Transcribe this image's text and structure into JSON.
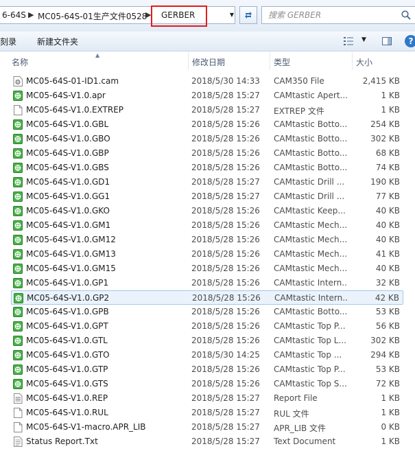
{
  "address": {
    "crumbs": [
      "6-64S",
      "MC05-64S-01生产文件0528",
      "GERBER"
    ],
    "separator": "▶"
  },
  "search": {
    "placeholder": "搜索 GERBER"
  },
  "toolbar": {
    "burn_label": "刻录",
    "new_folder_label": "新建文件夹"
  },
  "columns": {
    "name": "名称",
    "date": "修改日期",
    "type": "类型",
    "size": "大小"
  },
  "files": [
    {
      "name": "MC05-64S-01-ID1.cam",
      "date": "2018/5/30 14:33",
      "type": "CAM350 File",
      "size": "2,415 KB",
      "icon": "cam-icon"
    },
    {
      "name": "MC05-64S-V1.0.apr",
      "date": "2018/5/28 15:27",
      "type": "CAMtastic Apert...",
      "size": "1 KB",
      "icon": "camtastic-icon"
    },
    {
      "name": "MC05-64S-V1.0.EXTREP",
      "date": "2018/5/28 15:27",
      "type": "EXTREP 文件",
      "size": "1 KB",
      "icon": "blank-file-icon"
    },
    {
      "name": "MC05-64S-V1.0.GBL",
      "date": "2018/5/28 15:26",
      "type": "CAMtastic Botto...",
      "size": "254 KB",
      "icon": "camtastic-icon"
    },
    {
      "name": "MC05-64S-V1.0.GBO",
      "date": "2018/5/28 15:26",
      "type": "CAMtastic Botto...",
      "size": "302 KB",
      "icon": "camtastic-icon"
    },
    {
      "name": "MC05-64S-V1.0.GBP",
      "date": "2018/5/28 15:26",
      "type": "CAMtastic Botto...",
      "size": "68 KB",
      "icon": "camtastic-icon"
    },
    {
      "name": "MC05-64S-V1.0.GBS",
      "date": "2018/5/28 15:26",
      "type": "CAMtastic Botto...",
      "size": "74 KB",
      "icon": "camtastic-icon"
    },
    {
      "name": "MC05-64S-V1.0.GD1",
      "date": "2018/5/28 15:27",
      "type": "CAMtastic Drill ...",
      "size": "190 KB",
      "icon": "camtastic-icon"
    },
    {
      "name": "MC05-64S-V1.0.GG1",
      "date": "2018/5/28 15:27",
      "type": "CAMtastic Drill ...",
      "size": "77 KB",
      "icon": "camtastic-icon"
    },
    {
      "name": "MC05-64S-V1.0.GKO",
      "date": "2018/5/28 15:26",
      "type": "CAMtastic Keep...",
      "size": "40 KB",
      "icon": "camtastic-icon"
    },
    {
      "name": "MC05-64S-V1.0.GM1",
      "date": "2018/5/28 15:26",
      "type": "CAMtastic Mech...",
      "size": "40 KB",
      "icon": "camtastic-icon"
    },
    {
      "name": "MC05-64S-V1.0.GM12",
      "date": "2018/5/28 15:26",
      "type": "CAMtastic Mech...",
      "size": "40 KB",
      "icon": "camtastic-icon"
    },
    {
      "name": "MC05-64S-V1.0.GM13",
      "date": "2018/5/28 15:26",
      "type": "CAMtastic Mech...",
      "size": "41 KB",
      "icon": "camtastic-icon"
    },
    {
      "name": "MC05-64S-V1.0.GM15",
      "date": "2018/5/28 15:26",
      "type": "CAMtastic Mech...",
      "size": "40 KB",
      "icon": "camtastic-icon"
    },
    {
      "name": "MC05-64S-V1.0.GP1",
      "date": "2018/5/28 15:26",
      "type": "CAMtastic Intern...",
      "size": "32 KB",
      "icon": "camtastic-icon"
    },
    {
      "name": "MC05-64S-V1.0.GP2",
      "date": "2018/5/28 15:26",
      "type": "CAMtastic Intern...",
      "size": "42 KB",
      "icon": "camtastic-icon",
      "selected": true
    },
    {
      "name": "MC05-64S-V1.0.GPB",
      "date": "2018/5/28 15:26",
      "type": "CAMtastic Botto...",
      "size": "53 KB",
      "icon": "camtastic-icon"
    },
    {
      "name": "MC05-64S-V1.0.GPT",
      "date": "2018/5/28 15:26",
      "type": "CAMtastic Top P...",
      "size": "56 KB",
      "icon": "camtastic-icon"
    },
    {
      "name": "MC05-64S-V1.0.GTL",
      "date": "2018/5/28 15:26",
      "type": "CAMtastic Top L...",
      "size": "302 KB",
      "icon": "camtastic-icon"
    },
    {
      "name": "MC05-64S-V1.0.GTO",
      "date": "2018/5/30 14:25",
      "type": "CAMtastic Top ...",
      "size": "294 KB",
      "icon": "camtastic-icon"
    },
    {
      "name": "MC05-64S-V1.0.GTP",
      "date": "2018/5/28 15:26",
      "type": "CAMtastic Top P...",
      "size": "53 KB",
      "icon": "camtastic-icon"
    },
    {
      "name": "MC05-64S-V1.0.GTS",
      "date": "2018/5/28 15:26",
      "type": "CAMtastic Top S...",
      "size": "72 KB",
      "icon": "camtastic-icon"
    },
    {
      "name": "MC05-64S-V1.0.REP",
      "date": "2018/5/28 15:27",
      "type": "Report File",
      "size": "1 KB",
      "icon": "report-file-icon"
    },
    {
      "name": "MC05-64S-V1.0.RUL",
      "date": "2018/5/28 15:27",
      "type": "RUL 文件",
      "size": "1 KB",
      "icon": "blank-file-icon"
    },
    {
      "name": "MC05-64S-V1-macro.APR_LIB",
      "date": "2018/5/28 15:27",
      "type": "APR_LIB 文件",
      "size": "0 KB",
      "icon": "blank-file-icon"
    },
    {
      "name": "Status Report.Txt",
      "date": "2018/5/28 15:27",
      "type": "Text Document",
      "size": "1 KB",
      "icon": "text-document-icon"
    }
  ]
}
